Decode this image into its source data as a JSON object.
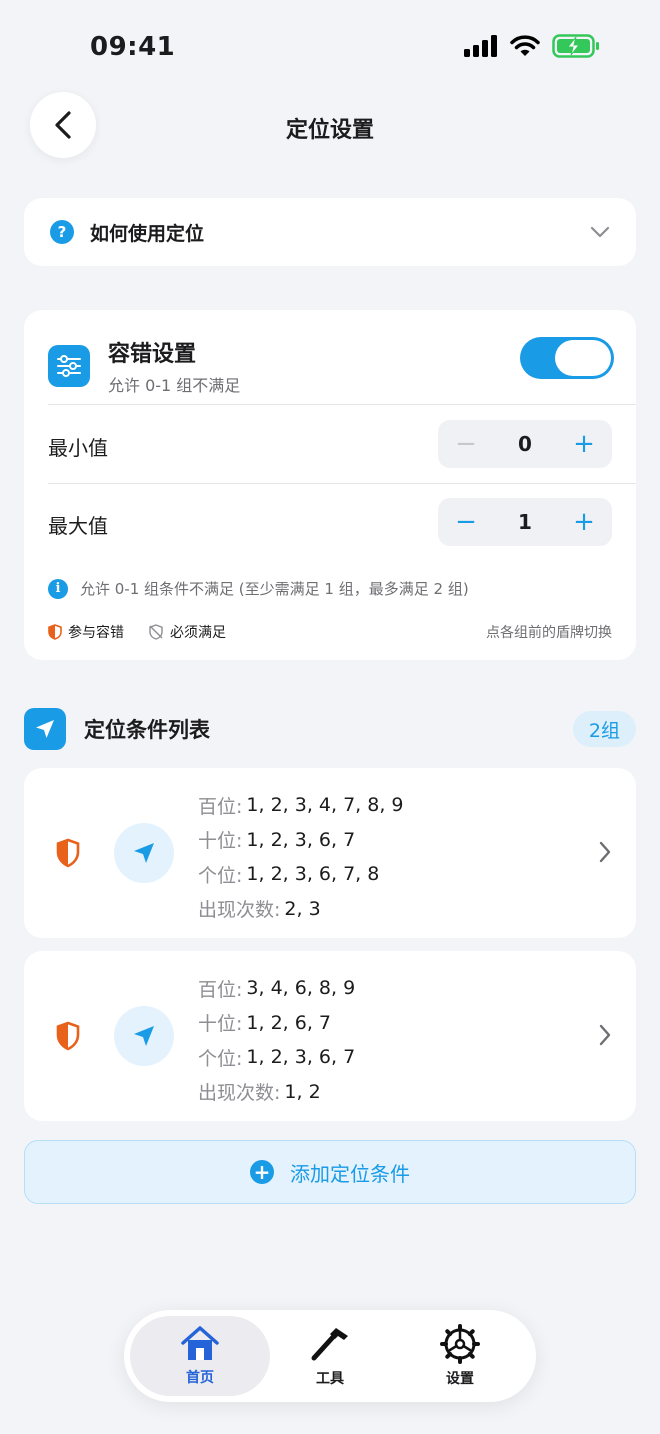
{
  "status": {
    "time": "09:41"
  },
  "nav": {
    "title": "定位设置"
  },
  "howto": {
    "label": "如何使用定位"
  },
  "tolerance": {
    "title": "容错设置",
    "subtitle": "允许 0-1 组不满足",
    "enabled": true,
    "min": {
      "label": "最小值",
      "value": "0",
      "minus": "−",
      "plus": "+"
    },
    "max": {
      "label": "最大值",
      "value": "1",
      "minus": "−",
      "plus": "+"
    },
    "info": "允许 0-1 组条件不满足 (至少需满足 1 组，最多满足 2 组)",
    "legend_participate": "参与容错",
    "legend_required": "必须满足",
    "legend_hint": "点各组前的盾牌切换"
  },
  "section": {
    "title": "定位条件列表",
    "badge": "2组"
  },
  "conditions": [
    {
      "hundreds_label": "百位:",
      "hundreds": "1, 2, 3, 4, 7, 8, 9",
      "tens_label": "十位:",
      "tens": "1, 2, 3, 6, 7",
      "ones_label": "个位:",
      "ones": "1, 2, 3, 6, 7, 8",
      "count_label": "出现次数:",
      "count": "2, 3"
    },
    {
      "hundreds_label": "百位:",
      "hundreds": "3, 4, 6, 8, 9",
      "tens_label": "十位:",
      "tens": "1, 2, 6, 7",
      "ones_label": "个位:",
      "ones": "1, 2, 3, 6, 7",
      "count_label": "出现次数:",
      "count": "1, 2"
    }
  ],
  "add_button": {
    "label": "添加定位条件",
    "icon_glyph": "+"
  },
  "tabbar": {
    "items": [
      {
        "label": "首页",
        "icon": "home-icon",
        "active": true
      },
      {
        "label": "工具",
        "icon": "hammer-icon",
        "active": false
      },
      {
        "label": "设置",
        "icon": "gear-icon",
        "active": false
      }
    ]
  },
  "colors": {
    "accent": "#1a9be6",
    "shield": "#e8621c",
    "tab_active": "#2563d8"
  }
}
